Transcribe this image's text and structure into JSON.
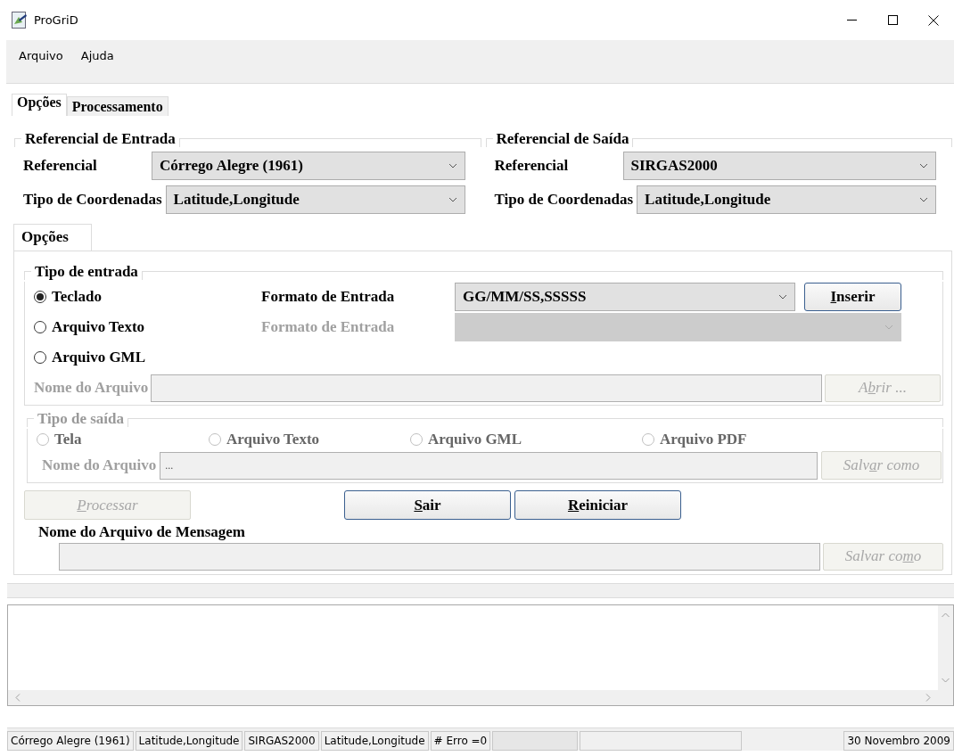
{
  "window": {
    "title": "ProGriD"
  },
  "menu": [
    {
      "label": "Arquivo"
    },
    {
      "label": "Ajuda"
    }
  ],
  "tabs": [
    {
      "label": "Opções",
      "selected": true
    },
    {
      "label": "Processamento",
      "selected": false
    }
  ],
  "reference_groups": [
    {
      "title": "Referencial de Entrada",
      "fields": [
        {
          "label": "Referencial",
          "value": "Córrego Alegre (1961)"
        },
        {
          "label": "Tipo de Coordenadas",
          "value": "Latitude,Longitude"
        }
      ]
    },
    {
      "title": "Referencial de Saída",
      "fields": [
        {
          "label": "Referencial",
          "value": "SIRGAS2000"
        },
        {
          "label": "Tipo de Coordenadas",
          "value": "Latitude,Longitude"
        }
      ]
    }
  ],
  "inner_tabs": [
    {
      "label": "Opções",
      "selected": true
    }
  ],
  "input_group": {
    "title": "Tipo de entrada",
    "disabled": false,
    "options": [
      {
        "label": "Teclado",
        "selected": true
      },
      {
        "label": "Arquivo Texto",
        "selected": false
      },
      {
        "label": "Arquivo GML",
        "selected": false
      }
    ],
    "format_rows": [
      {
        "label": "Formato de Entrada",
        "value": "GG/MM/SS,SSSSS",
        "disabled": false
      },
      {
        "label": "Formato de Entrada",
        "disabled": true
      }
    ],
    "insert_button": {
      "key": "I",
      "post": "nserir",
      "disabled": false
    },
    "file": {
      "label": "Nome do Arquivo",
      "disabled": true
    },
    "open_button": {
      "pre": "A",
      "key": "b",
      "post": "rir ...",
      "disabled": true
    }
  },
  "output_group": {
    "title": "Tipo de saída",
    "disabled": true,
    "options": [
      {
        "label": "Tela",
        "selected": false
      },
      {
        "label": "Arquivo Texto",
        "selected": false
      },
      {
        "label": "Arquivo GML",
        "selected": false
      },
      {
        "label": "Arquivo PDF",
        "selected": false
      }
    ],
    "file": {
      "label": "Nome do Arquivo",
      "value": "...",
      "disabled": true
    },
    "save_button": {
      "pre": "Salv",
      "key": "a",
      "post": "r como",
      "disabled": true
    }
  },
  "actions": [
    {
      "key": "P",
      "post": "rocessar",
      "disabled": true
    },
    {
      "key": "S",
      "post": "air",
      "disabled": false
    },
    {
      "key": "R",
      "post": "einiciar",
      "disabled": false
    }
  ],
  "message": {
    "label": "Nome do Arquivo de Mensagem",
    "disabled": true,
    "save_button": {
      "pre": "Salvar co",
      "key": "m",
      "post": "o",
      "disabled": true
    }
  },
  "status_bar": [
    {
      "text": "Córrego Alegre (1961)"
    },
    {
      "text": "Latitude,Longitude"
    },
    {
      "text": "SIRGAS2000"
    },
    {
      "text": "Latitude,Longitude"
    },
    {
      "text": "# Erro =0"
    },
    {
      "kind": "grey"
    },
    {
      "kind": "blank"
    },
    {
      "text": "30 Novembro 2009"
    }
  ]
}
